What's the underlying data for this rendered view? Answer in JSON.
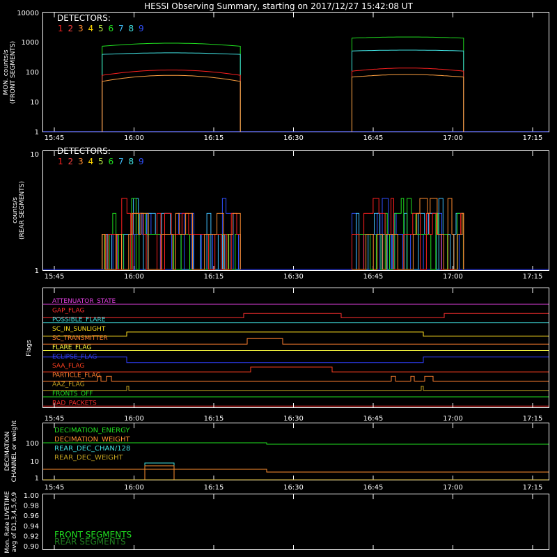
{
  "title": "HESSI Observing Summary, starting on 2017/12/27 15:42:08 UT",
  "colors": {
    "axis": "#ffffff",
    "det": [
      "#ff2020",
      "#ff4040",
      "#ff8c30",
      "#ffd700",
      "#b0e040",
      "#20e020",
      "#40c0ff",
      "#40e0e0",
      "#3050ff"
    ],
    "front_main": "#20e020",
    "front_cyan": "#40e0e0",
    "front_red": "#ff2020",
    "front_orange": "#ffa040",
    "base_blue": "#3040ff",
    "live_front": "#20e020",
    "live_rear": "#208020"
  },
  "time_ticks": [
    "15:45",
    "16:00",
    "16:15",
    "16:30",
    "16:45",
    "17:00",
    "17:15"
  ],
  "panel1": {
    "ylabel_1": "MON. counts/s",
    "ylabel_2": "(FRONT SEGMENTS)",
    "yticks": [
      "10000",
      "1000",
      "100",
      "10",
      "1"
    ],
    "legend_title": "DETECTORS:",
    "legend_nums": [
      "1",
      "2",
      "3",
      "4",
      "5",
      "6",
      "7",
      "8",
      "9"
    ]
  },
  "panel2": {
    "ylabel_1": "counts/s",
    "ylabel_2": "(REAR SEGMENTS)",
    "yticks": [
      "10",
      "1"
    ],
    "legend_title": "DETECTORS:",
    "legend_nums": [
      "1",
      "2",
      "3",
      "4",
      "5",
      "6",
      "7",
      "8",
      "9"
    ]
  },
  "panel3": {
    "ylabel": "Flags",
    "flags": [
      {
        "label": "ATTENUATOR_STATE",
        "color": "#e040e0"
      },
      {
        "label": "GAP_FLAG",
        "color": "#ff3030"
      },
      {
        "label": "POSSIBLE_FLARE",
        "color": "#40e0e0"
      },
      {
        "label": "SC_IN_SUNLIGHT",
        "color": "#ffe020"
      },
      {
        "label": "SC_TRANSMITTER",
        "color": "#ff8030"
      },
      {
        "label": "FLARE_FLAG",
        "color": "#ffff40"
      },
      {
        "label": "ECLIPSE_FLAG",
        "color": "#3040ff"
      },
      {
        "label": "SAA_FLAG",
        "color": "#ff4020"
      },
      {
        "label": "PARTICLE_FLAG",
        "color": "#ff8030"
      },
      {
        "label": "AAZ_FLAG",
        "color": "#c0a020"
      },
      {
        "label": "FRONTS_OFF",
        "color": "#20e020"
      },
      {
        "label": "BAD_PACKETS",
        "color": "#ff3030"
      }
    ]
  },
  "panel4": {
    "ylabel_1": "DECIMATION",
    "ylabel_2": "CHANNEL or weight",
    "yticks": [
      "100",
      "10",
      "1"
    ],
    "legend": [
      {
        "label": "DECIMATION_ENERGY",
        "color": "#20e020"
      },
      {
        "label": "DECIMATION_WEIGHT",
        "color": "#ff9030"
      },
      {
        "label": "REAR_DEC_CHAN/128",
        "color": "#40e0e0"
      },
      {
        "label": "REAR_DEC_WEIGHT",
        "color": "#c0a020"
      }
    ]
  },
  "panel5": {
    "ylabel_1": "Mon. Rate LIVETIME",
    "ylabel_2": "avg of D1,3,4,5,6,9",
    "yticks": [
      "1.00",
      "0.98",
      "0.96",
      "0.94",
      "0.92",
      "0.90"
    ],
    "legend": [
      {
        "label": "FRONT SEGMENTS",
        "color": "#20e020"
      },
      {
        "label": "REAR SEGMENTS",
        "color": "#208020"
      }
    ]
  },
  "chart_data": [
    {
      "type": "line",
      "title": "HESSI Observing Summary, starting on 2017/12/27 15:42:08 UT",
      "xlabel": "",
      "ylabel": "MON. counts/s (FRONT SEGMENTS)",
      "yscale": "log",
      "ylim": [
        1,
        10000
      ],
      "x_ticks": [
        "15:45",
        "16:00",
        "16:15",
        "16:30",
        "16:45",
        "17:00",
        "17:15"
      ],
      "x": [
        "15:54",
        "15:56",
        "16:00",
        "16:05",
        "16:10",
        "16:15",
        "16:20",
        "16:22",
        "16:40",
        "16:42",
        "16:45",
        "16:50",
        "16:55",
        "17:00",
        "17:02"
      ],
      "series": [
        {
          "values": [
            750,
            900,
            900,
            920,
            930,
            940,
            930,
            750,
            1400,
            1500,
            1500,
            1520,
            1520,
            1530,
            1520
          ]
        },
        {
          "values": [
            400,
            420,
            430,
            440,
            445,
            450,
            445,
            420,
            520,
            540,
            545,
            550,
            550,
            555,
            550
          ]
        },
        {
          "values": [
            80,
            90,
            100,
            110,
            115,
            120,
            115,
            80,
            110,
            120,
            125,
            130,
            135,
            140,
            135
          ]
        },
        {
          "values": [
            50,
            55,
            65,
            70,
            75,
            80,
            75,
            50,
            70,
            75,
            78,
            80,
            82,
            85,
            80
          ]
        }
      ]
    },
    {
      "type": "line",
      "title": "",
      "xlabel": "",
      "ylabel": "counts/s (REAR SEGMENTS)",
      "yscale": "log",
      "ylim": [
        1,
        10
      ],
      "x_ticks": [
        "15:45",
        "16:00",
        "16:15",
        "16:30",
        "16:45",
        "17:00",
        "17:15"
      ],
      "notes_levels": [
        2,
        3,
        4
      ]
    },
    {
      "type": "line",
      "title": "",
      "xlabel": "",
      "ylabel": "DECIMATION CHANNEL or weight",
      "yscale": "log",
      "ylim": [
        0.6,
        300
      ],
      "x_ticks": [
        "15:45",
        "16:00",
        "16:15",
        "16:30",
        "16:45",
        "17:00",
        "17:15"
      ],
      "x": [
        "15:42",
        "16:26",
        "16:27",
        "17:23"
      ],
      "series": [
        {
          "name": "DECIMATION_ENERGY",
          "values": [
            100,
            100,
            80,
            80
          ]
        },
        {
          "name": "DECIMATION_WEIGHT",
          "values": [
            4,
            4,
            2.5,
            2.5
          ]
        }
      ]
    },
    {
      "type": "line",
      "title": "",
      "xlabel": "",
      "ylabel": "Mon. Rate LIVETIME avg of D1,3,4,5,6,9",
      "ylim": [
        0.9,
        1.0
      ],
      "x_ticks": [
        "15:45",
        "16:00",
        "16:15",
        "16:30",
        "16:45",
        "17:00",
        "17:15"
      ],
      "series": [
        {
          "name": "FRONT SEGMENTS",
          "values": []
        },
        {
          "name": "REAR SEGMENTS",
          "values": []
        }
      ]
    }
  ]
}
